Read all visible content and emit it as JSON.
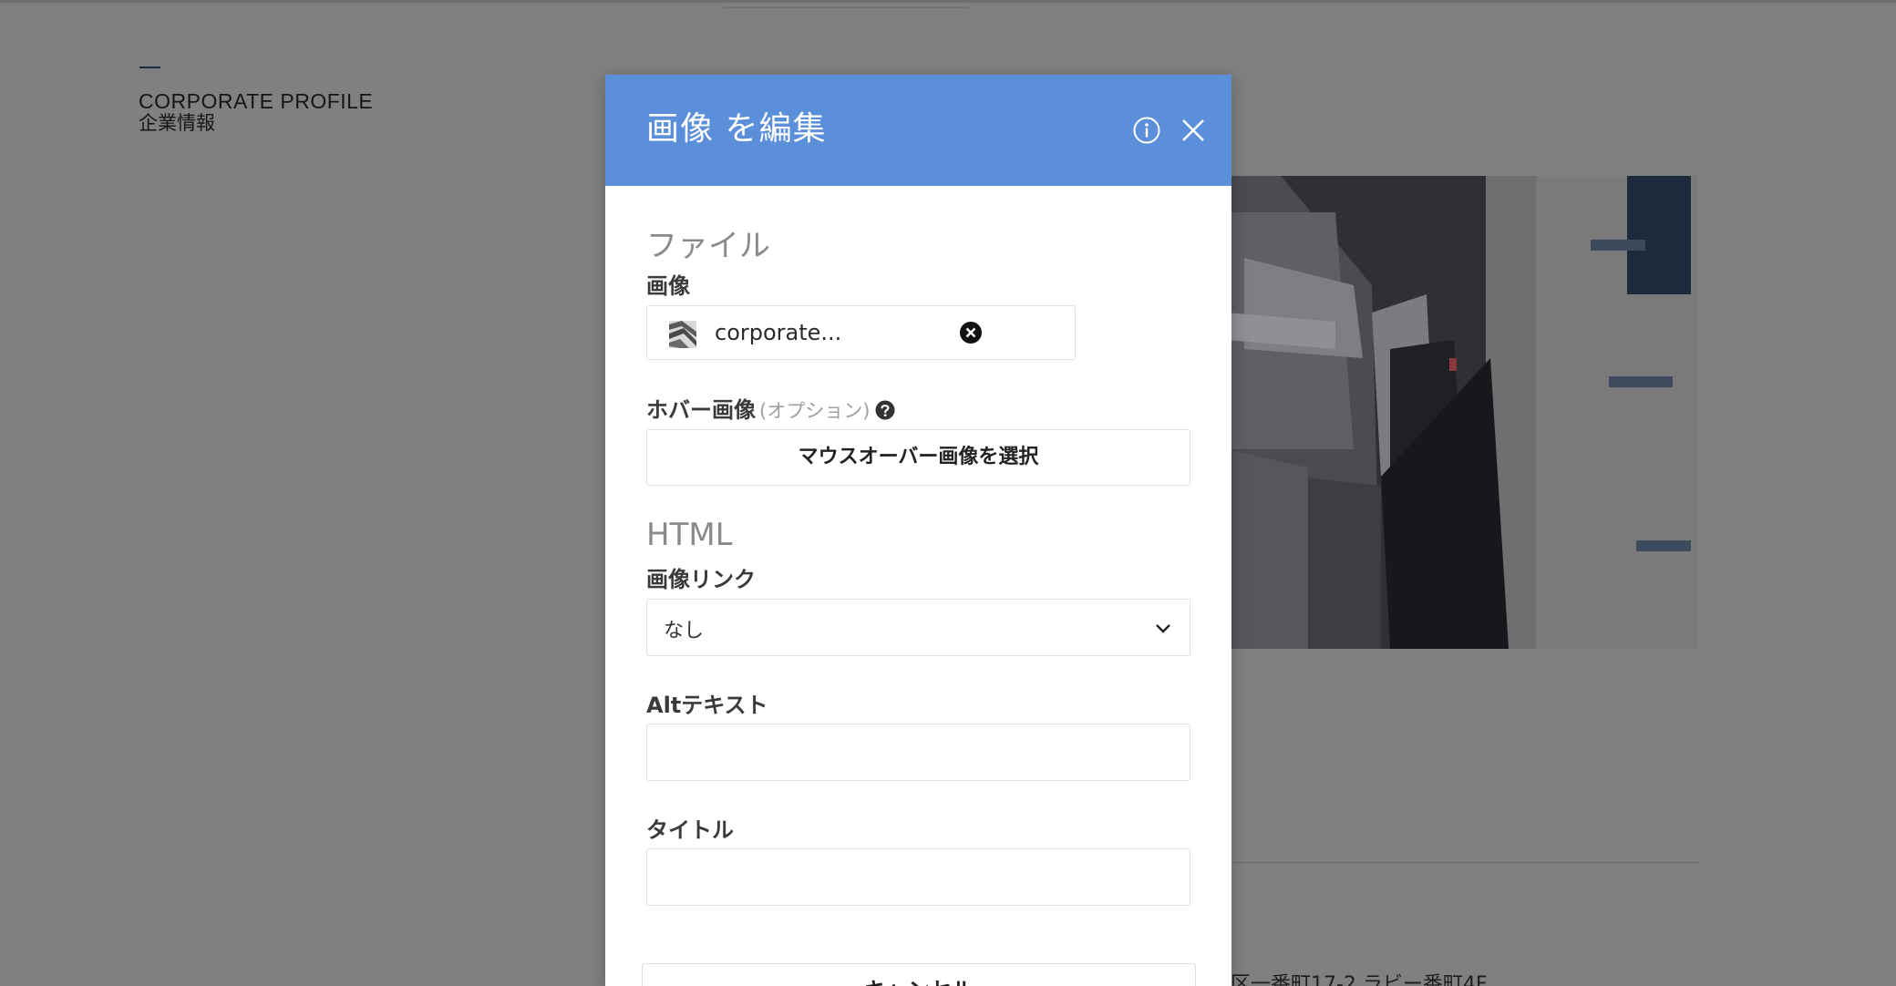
{
  "background": {
    "profile_en": "CORPORATE PROFILE",
    "profile_jp": "企業情報",
    "address": "区一番町17-2 ラビー番町4F"
  },
  "modal": {
    "title": "画像 を編集",
    "info_icon": "info-circle-icon",
    "close_icon": "close-icon",
    "header_color": "#5b8fd9",
    "file_section": {
      "title": "ファイル",
      "image_label": "画像",
      "file_name": "corporate...",
      "hover_label": "ホバー画像",
      "hover_optional": "(オプション)",
      "hover_button": "マウスオーバー画像を選択"
    },
    "html_section": {
      "title": "HTML",
      "link_label": "画像リンク",
      "link_value": "なし",
      "alt_label": "Altテキスト",
      "alt_value": "",
      "title_label": "タイトル",
      "title_value": ""
    },
    "cancel_label": "キャンセル"
  }
}
